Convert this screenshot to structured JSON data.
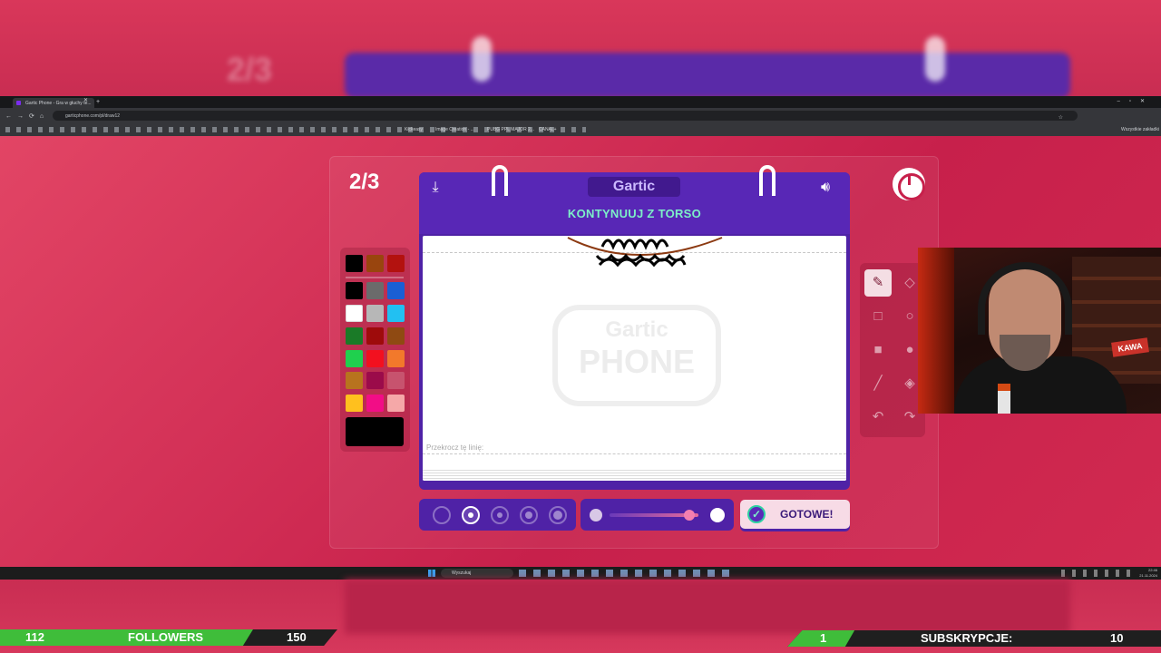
{
  "browser": {
    "tab_title": "Gartic Phone - Gra w głuchy te...",
    "url": "garticphone.com/pl/draw12",
    "bookmarks": [
      "Kickeasy",
      "Image Creation - ...",
      "PUBG PPL MAJOR 2...",
      "CANAL+"
    ],
    "all_bookmarks_label": "Wszystkie zakładki"
  },
  "game": {
    "round": "2/3",
    "logo": "Gartic",
    "prompt": "KONTYNUUJ Z TORSO",
    "cross_line_hint": "Przekrocz tę linię:",
    "watermark_top": "Gartic",
    "watermark_bottom": "PHONE",
    "done_label": "GOTOWE!",
    "selected_brush_size": 2,
    "opacity_level": 0.9
  },
  "palette": {
    "colors": [
      "#000000",
      "#99450e",
      "#b3120f",
      "#000000",
      "#6b6b6b",
      "#1a5fd4",
      "#ffffff",
      "#b7b7b7",
      "#22c0f2",
      "#1a7a27",
      "#9e0b0b",
      "#8f4a12",
      "#1fd04e",
      "#f2101f",
      "#f2792b",
      "#b8731e",
      "#9b0b4a",
      "#c7536e",
      "#ffc01e",
      "#f20d86",
      "#f5a8a8"
    ],
    "selected": "#000000"
  },
  "tools": [
    "pencil-icon",
    "eraser-icon",
    "rectangle-outline-icon",
    "ellipse-outline-icon",
    "rectangle-filled-icon",
    "ellipse-filled-icon",
    "line-icon",
    "fill-bucket-icon",
    "undo-icon",
    "redo-icon"
  ],
  "taskbar": {
    "search_placeholder": "Wyszukaj",
    "time": "22:46",
    "date": "21.11.2024"
  },
  "overlay": {
    "followers_current": "112",
    "followers_label": "FOLLOWERS",
    "followers_goal": "150",
    "followers_progress": 0.75,
    "subs_current": "1",
    "subs_label": "SUBSKRYPCJE:",
    "subs_goal": "10",
    "subs_progress": 0.1
  },
  "webcam": {
    "sign_text": "KAWA"
  }
}
